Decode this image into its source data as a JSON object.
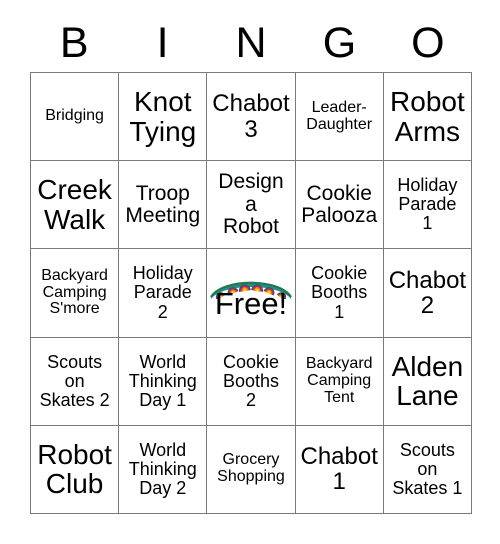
{
  "card": {
    "title_letters": [
      "B",
      "I",
      "N",
      "G",
      "O"
    ],
    "free_space": {
      "label": "Free!",
      "arch_icon": "rainbow-arch-icon",
      "colors": {
        "teal": "#2e8b7a",
        "green": "#1f7a4d",
        "blue": "#2b4fa2",
        "red": "#d62b1f",
        "orange": "#f08a16",
        "yellow": "#f5d61a"
      }
    },
    "rows": [
      [
        {
          "text": "Bridging",
          "size": "sm"
        },
        {
          "text": "Knot\nTying",
          "size": "xxl"
        },
        {
          "text": "Chabot\n3",
          "size": "xl"
        },
        {
          "text": "Leader-\nDaughter",
          "size": "sm"
        },
        {
          "text": "Robot\nArms",
          "size": "xxl"
        }
      ],
      [
        {
          "text": "Creek\nWalk",
          "size": "xxl"
        },
        {
          "text": "Troop\nMeeting",
          "size": "lg"
        },
        {
          "text": "Design\na\nRobot",
          "size": "lg"
        },
        {
          "text": "Cookie\nPalooza",
          "size": "lg"
        },
        {
          "text": "Holiday\nParade\n1",
          "size": "md"
        }
      ],
      [
        {
          "text": "Backyard\nCamping\nS'more",
          "size": "sm"
        },
        {
          "text": "Holiday\nParade\n2",
          "size": "md"
        },
        {
          "text": "Free!",
          "size": "free"
        },
        {
          "text": "Cookie\nBooths\n1",
          "size": "md"
        },
        {
          "text": "Chabot\n2",
          "size": "xl"
        }
      ],
      [
        {
          "text": "Scouts\non\nSkates 2",
          "size": "md"
        },
        {
          "text": "World\nThinking\nDay 1",
          "size": "md"
        },
        {
          "text": "Cookie\nBooths\n2",
          "size": "md"
        },
        {
          "text": "Backyard\nCamping\nTent",
          "size": "sm"
        },
        {
          "text": "Alden\nLane",
          "size": "xxl"
        }
      ],
      [
        {
          "text": "Robot\nClub",
          "size": "xxl"
        },
        {
          "text": "World\nThinking\nDay 2",
          "size": "md"
        },
        {
          "text": "Grocery\nShopping",
          "size": "sm"
        },
        {
          "text": "Chabot\n1",
          "size": "xl"
        },
        {
          "text": "Scouts\non\nSkates 1",
          "size": "md"
        }
      ]
    ]
  }
}
